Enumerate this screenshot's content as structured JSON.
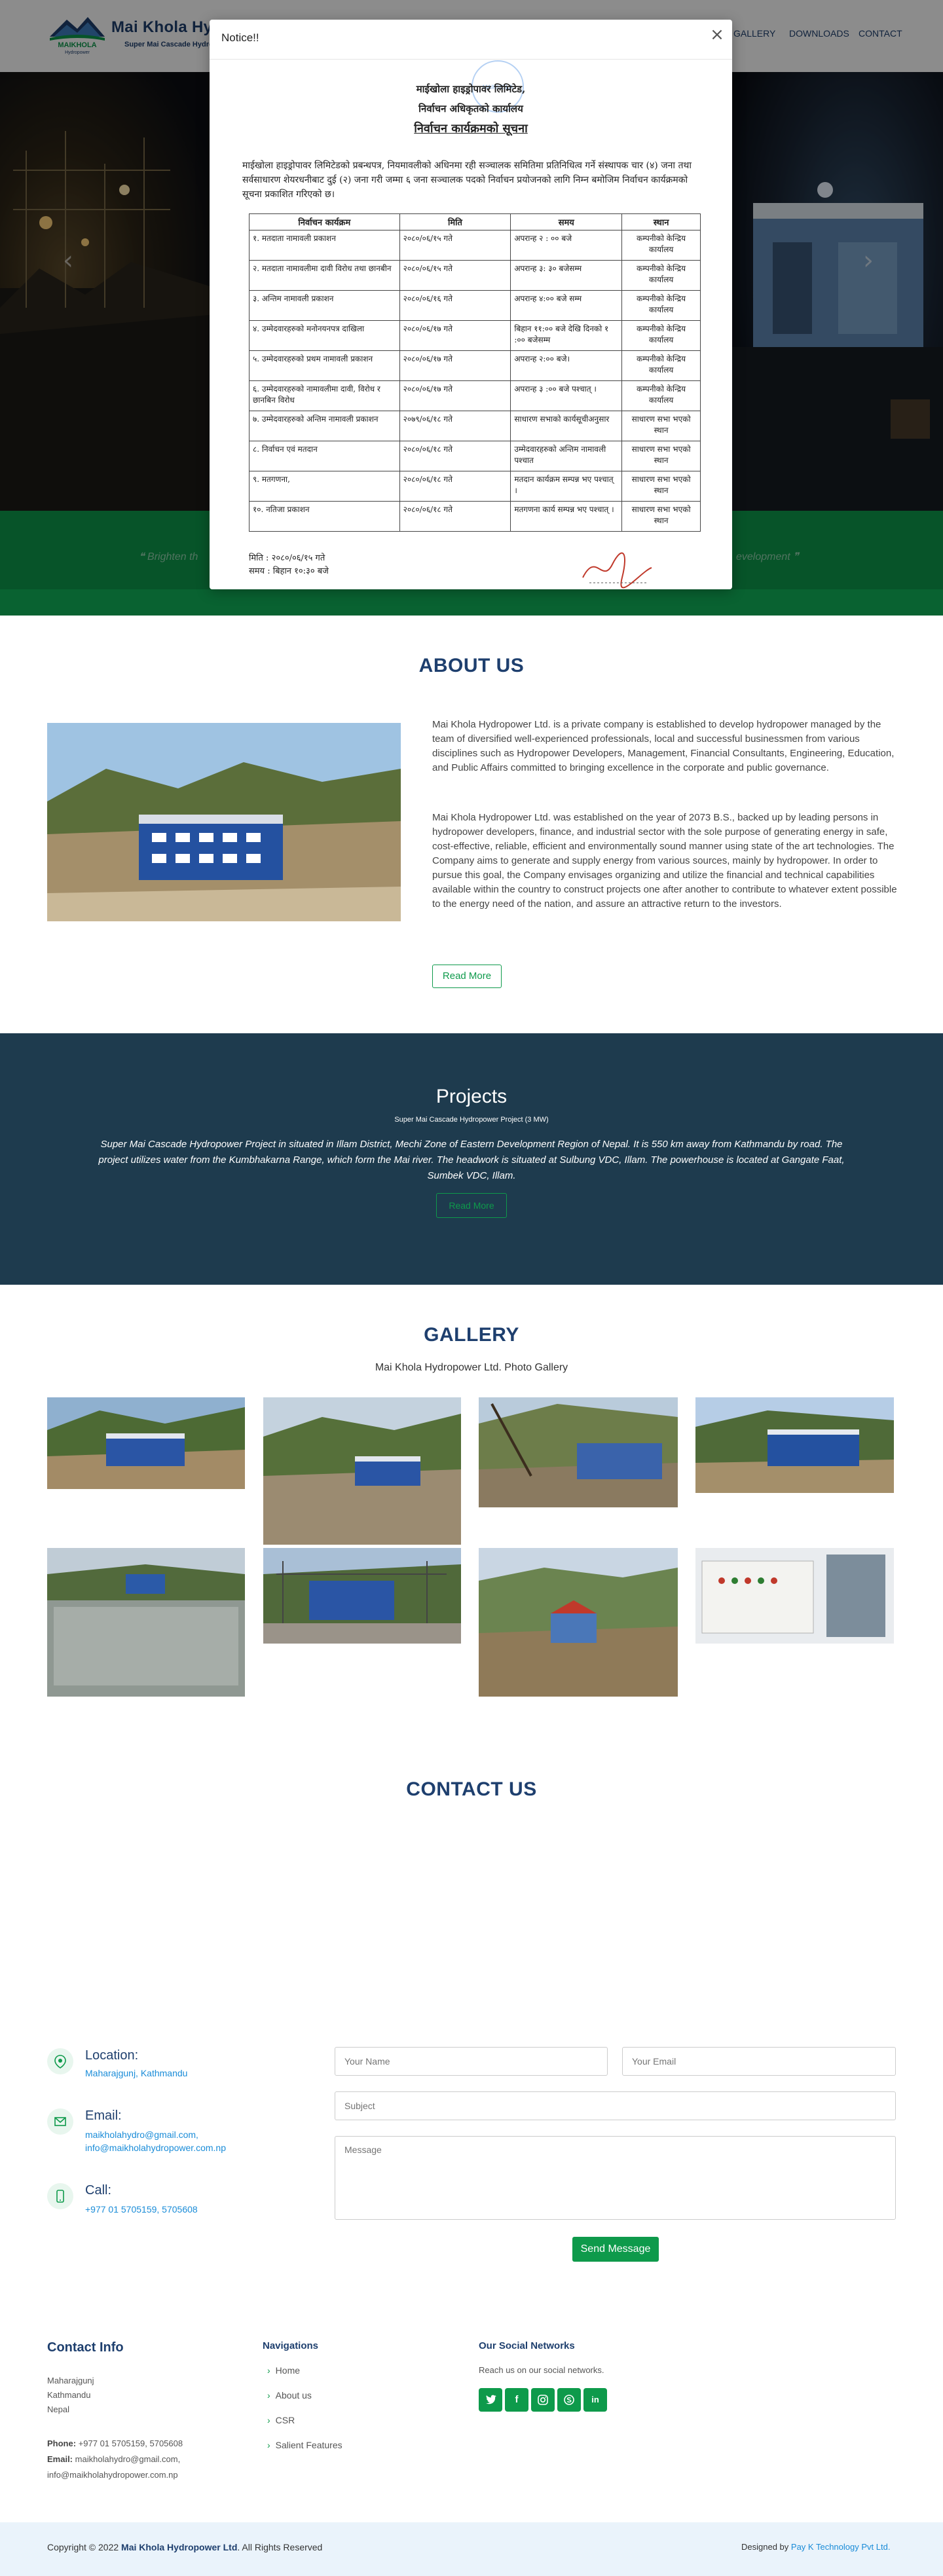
{
  "header": {
    "logo_text": "MAIKHOLA",
    "logo_small": "Hydropower",
    "company": "Mai Khola Hydropower Ltd.",
    "subtitle": "Super Mai Cascade Hydropower Project",
    "nav": [
      "GALLERY",
      "DOWNLOADS",
      "CONTACT"
    ]
  },
  "hero": {
    "quote_left": "❝ Brighten th",
    "quote_right": "evelopment ❞"
  },
  "modal": {
    "title": "Notice!!",
    "close_icon": "×",
    "doc": {
      "org": "माईखोला हाइड्रोपावर लिमिटेड,",
      "office": "निर्वाचन अधिकृतको कार्यालय",
      "heading": "निर्वाचन कार्यक्रमको सूचना",
      "stamp_text": "MAIKHOLA",
      "paragraph": "माईखोला हाइड्रोपावर लिमिटेडको प्रबन्धपत्र, नियमावलीको अधिनमा रही सञ्चालक समितिमा प्रतिनिधित्व गर्ने संस्थापक चार (४) जना तथा सर्वसाधारण शेयरधनीबाट दुई (२) जना गरी जम्मा ६ जना सञ्चालक पदको निर्वाचन प्रयोजनको लागि निम्न बमोजिम निर्वाचन कार्यक्रमको सूचना प्रकाशित गरिएको छ।",
      "columns": [
        "निर्वाचन कार्यक्रम",
        "मिति",
        "समय",
        "स्थान"
      ],
      "rows": [
        [
          "१. मतदाता नामावली प्रकाशन",
          "२०८०/०६/१५ गते",
          "अपरान्ह २ : ०० बजे",
          "कम्पनीको केन्द्रिय कार्यालय"
        ],
        [
          "२. मतदाता नामावलीमा दावी विरोध तथा छानबीन",
          "२०८०/०६/१५ गते",
          "अपरान्ह ३: ३० बजेसम्म",
          "कम्पनीको केन्द्रिय कार्यालय"
        ],
        [
          "३. अन्तिम नामावली प्रकाशन",
          "२०८०/०६/१६ गते",
          "अपरान्ह ४:०० बजे सम्म",
          "कम्पनीको केन्द्रिय कार्यालय"
        ],
        [
          "४. उम्मेदवारहरुको मनोनयनपत्र दाखिला",
          "२०८०/०६/१७ गते",
          "बिहान ११:०० बजे देखि दिनको १ :०० बजेसम्म",
          "कम्पनीको केन्द्रिय कार्यालय"
        ],
        [
          "५. उम्मेदवारहरुको प्रथम नामावली प्रकाशन",
          "२०८०/०६/१७ गते",
          "अपरान्ह २:०० बजे।",
          "कम्पनीको केन्द्रिय कार्यालय"
        ],
        [
          "६. उम्मेदवारहरुको नामावलीमा दावी, विरोध र छानबिन विरोध",
          "२०८०/०६/१७ गते",
          "अपरान्ह ३ :०० बजे पश्चात् ।",
          "कम्पनीको केन्द्रिय कार्यालय"
        ],
        [
          "७. उम्मेदवारहरुको अन्तिम नामावली प्रकाशन",
          "२०७९/०६/१८ गते",
          "साधारण सभाको कार्यसूचीअनुसार",
          "साधारण सभा भएको स्थान"
        ],
        [
          "८. निर्वाचन एवं मतदान",
          "२०८०/०६/१८ गते",
          "उम्मेदवारहरुको अन्तिम नामावली पश्चात",
          "साधारण सभा भएको स्थान"
        ],
        [
          "९. मतगणना,",
          "२०८०/०६/१८ गते",
          "मतदान कार्यक्रम सम्पन्न भए पश्चात् ।",
          "साधारण सभा भएको स्थान"
        ],
        [
          "१०. नतिजा प्रकाशन",
          "२०८०/०६/१८ गते",
          "मतगणना कार्य सम्पन्न भए पश्चात् ।",
          "साधारण सभा भएको स्थान"
        ]
      ],
      "date_line": "मिति : २०८०/०६/१५ गते",
      "time_line": "समय : बिहान १०:३० बजे"
    }
  },
  "about": {
    "title": "ABOUT US",
    "p1": "Mai Khola Hydropower Ltd. is a private company is established to develop hydropower managed by the team of diversified well-experienced professionals, local and successful businessmen from various disciplines such as Hydropower Developers, Management, Financial Consultants, Engineering, Education, and Public Affairs committed to bringing excellence in the corporate and public governance.",
    "p2": "Mai Khola Hydropower Ltd. was established on the year of 2073 B.S., backed up by leading persons in hydropower developers, finance, and industrial sector with the sole purpose of generating energy in safe, cost-effective, reliable, efficient and environmentally sound manner using state of the art technologies. The Company aims to generate and supply energy from various sources, mainly by hydropower. In order to pursue this goal, the Company envisages organizing and utilize the financial and technical capabilities available within the country to construct projects one after another to contribute to whatever extent possible to the energy need of the nation, and assure an attractive return to the investors.",
    "read_more": "Read More"
  },
  "projects": {
    "title": "Projects",
    "subtitle": "Super Mai Cascade Hydropower Project (3 MW)",
    "description": "Super Mai Cascade Hydropower Project in situated in Illam District, Mechi Zone of Eastern Development Region of Nepal. It is 550 km away from Kathmandu by road. The project utilizes water from the Kumbhakarna Range, which form the Mai river. The headwork is situated at Sulbung VDC, Illam. The powerhouse is located at Gangate Faat, Sumbek VDC, Illam.",
    "read_more": "Read More"
  },
  "gallery": {
    "title": "GALLERY",
    "subtitle": "Mai Khola Hydropower Ltd. Photo Gallery"
  },
  "contact": {
    "title": "CONTACT US",
    "location_label": "Location:",
    "location_value": "Maharajgunj, Kathmandu",
    "email_label": "Email:",
    "email_1": "maikholahydro@gmail.com,",
    "email_2": "info@maikholahydropower.com.np",
    "call_label": "Call:",
    "call_value": "+977 01 5705159, 5705608",
    "name_placeholder": "Your Name",
    "email_placeholder": "Your Email",
    "subject_placeholder": "Subject",
    "message_placeholder": "Message",
    "send": "Send Message"
  },
  "footer": {
    "contact_title": "Contact Info",
    "address_1": "Maharajgunj",
    "address_2": "Kathmandu",
    "address_3": "Nepal",
    "phone_label": "Phone:",
    "phone_value": "+977 01 5705159, 5705608",
    "email_label": "Email:",
    "email_value_1": "maikholahydro@gmail.com,",
    "email_value_2": "info@maikholahydropower.com.np",
    "nav_title": "Navigations",
    "nav_items": [
      "Home",
      "About us",
      "CSR",
      "Salient Features"
    ],
    "social_title": "Our Social Networks",
    "social_text": "Reach us on our social networks.",
    "social_icons": [
      "twitter-icon",
      "facebook-icon",
      "instagram-icon",
      "skype-icon",
      "linkedin-icon"
    ],
    "copyright_prefix": "Copyright © 2022",
    "copyright_company": "Mai Khola Hydropower Ltd",
    "copyright_suffix": ". All Rights Reserved",
    "designed_prefix": "Designed by",
    "designed_company": "Pay K Technology Pvt Ltd."
  },
  "colors": {
    "brand_blue": "#1e3f6e",
    "brand_green": "#0e9a4b",
    "projects_bg": "#1e3b4e",
    "link_blue": "#1a8cd8"
  }
}
